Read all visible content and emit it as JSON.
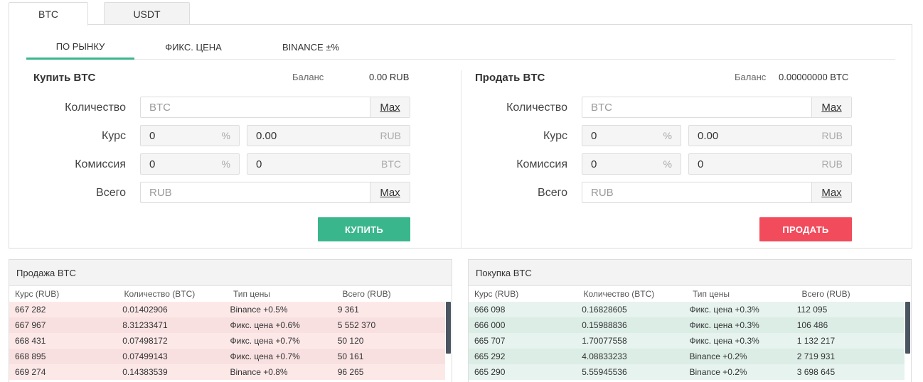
{
  "currency_tabs": [
    "BTC",
    "USDT"
  ],
  "mode_tabs": [
    "ПО РЫНКУ",
    "ФИКС. ЦЕНА",
    "BINANCE ±%"
  ],
  "buy": {
    "title": "Купить BTC",
    "balance_label": "Баланс",
    "balance_value": "0.00 RUB",
    "labels": {
      "quantity": "Количество",
      "rate": "Курс",
      "commission": "Комиссия",
      "total": "Всего"
    },
    "quantity_placeholder": "BTC",
    "max_label": "Max",
    "rate_percent": "0",
    "rate_value": "0.00",
    "rate_unit": "RUB",
    "commission_percent": "0",
    "commission_value": "0",
    "commission_unit": "BTC",
    "total_placeholder": "RUB",
    "percent_sign": "%",
    "button": "КУПИТЬ"
  },
  "sell": {
    "title": "Продать BTC",
    "balance_label": "Баланс",
    "balance_value": "0.00000000 BTC",
    "labels": {
      "quantity": "Количество",
      "rate": "Курс",
      "commission": "Комиссия",
      "total": "Всего"
    },
    "quantity_placeholder": "BTC",
    "max_label": "Max",
    "rate_percent": "0",
    "rate_value": "0.00",
    "rate_unit": "RUB",
    "commission_percent": "0",
    "commission_value": "0",
    "commission_unit": "RUB",
    "total_placeholder": "RUB",
    "percent_sign": "%",
    "button": "ПРОДАТЬ"
  },
  "colors": {
    "buy": "#3ab68d",
    "sell": "#f14b5c",
    "accent": "#3ab68d"
  },
  "sell_book": {
    "title": "Продажа BTC",
    "columns": [
      "Курс (RUB)",
      "Количество (BTC)",
      "Тип цены",
      "Всего (RUB)"
    ],
    "rows": [
      [
        "667 282",
        "0.01402906",
        "Binance +0.5%",
        "9 361"
      ],
      [
        "667 967",
        "8.31233471",
        "Фикс. цена +0.6%",
        "5 552 370"
      ],
      [
        "668 431",
        "0.07498172",
        "Фикс. цена +0.7%",
        "50 120"
      ],
      [
        "668 895",
        "0.07499143",
        "Фикс. цена +0.7%",
        "50 161"
      ],
      [
        "669 274",
        "0.14383539",
        "Binance +0.8%",
        "96 265"
      ]
    ]
  },
  "buy_book": {
    "title": "Покупка BTC",
    "columns": [
      "Курс (RUB)",
      "Количество (BTC)",
      "Тип цены",
      "Всего (RUB)"
    ],
    "rows": [
      [
        "666 098",
        "0.16828605",
        "Фикс. цена +0.3%",
        "112 095"
      ],
      [
        "666 000",
        "0.15988836",
        "Фикс. цена +0.3%",
        "106 486"
      ],
      [
        "665 707",
        "1.70077558",
        "Фикс. цена +0.3%",
        "1 132 217"
      ],
      [
        "665 292",
        "4.08833233",
        "Binance +0.2%",
        "2 719 931"
      ],
      [
        "665 290",
        "5.55945536",
        "Binance +0.2%",
        "3 698 645"
      ]
    ]
  }
}
